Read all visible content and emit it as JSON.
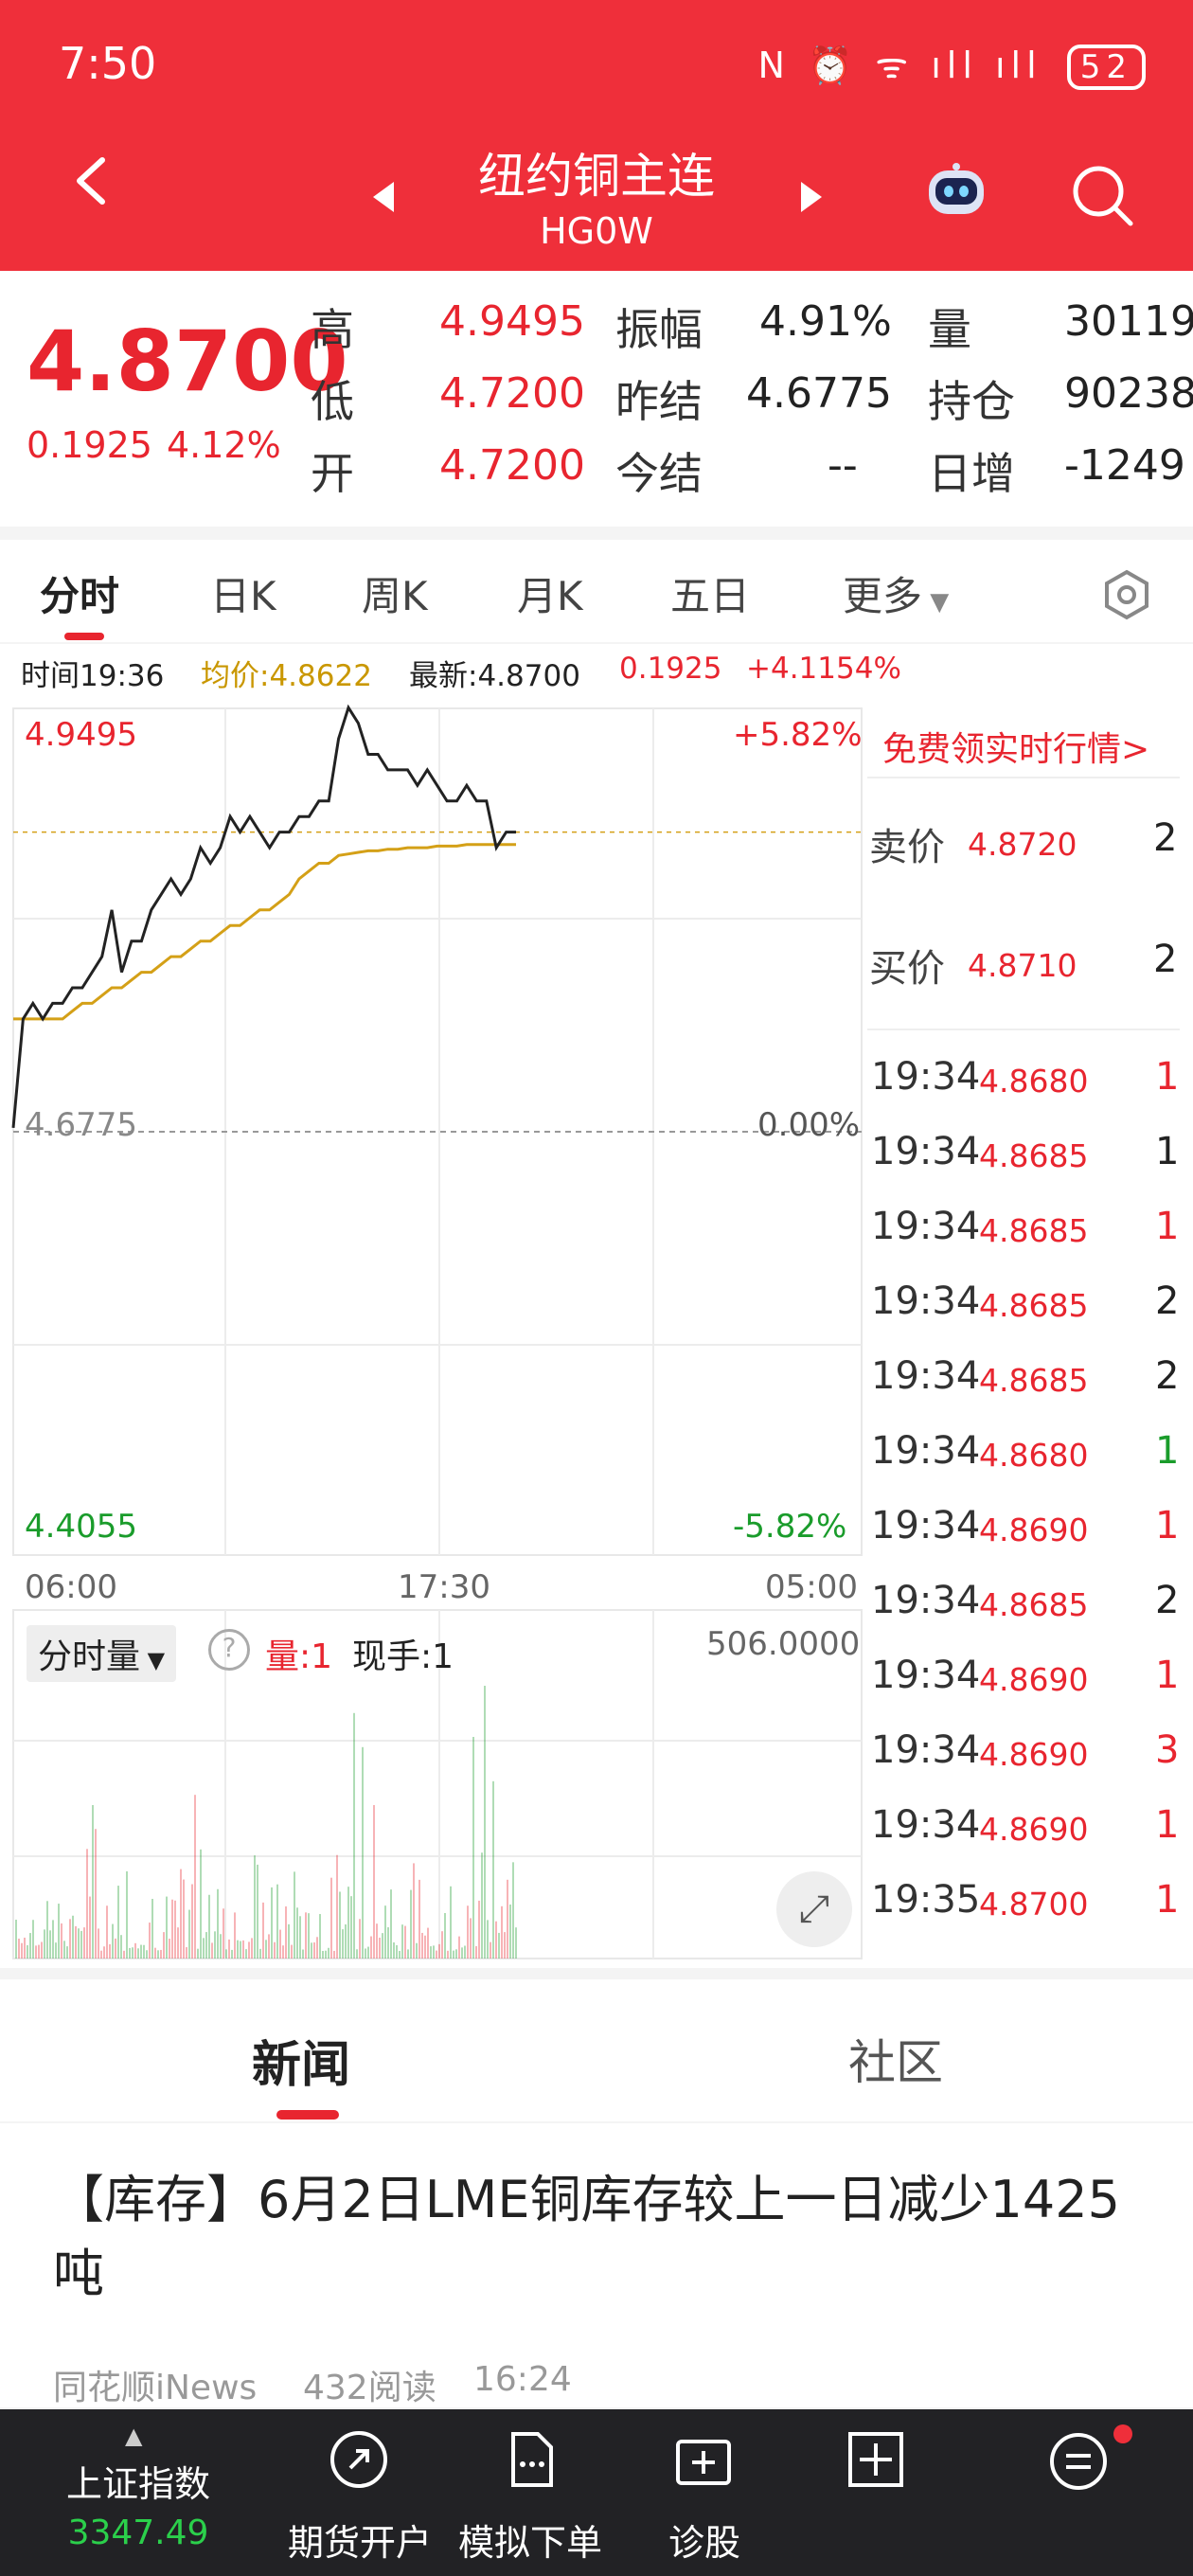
{
  "status_bar": {
    "time": "7:50",
    "icons": "N ⏰ ᯤ ıll ıll",
    "battery": "52"
  },
  "header": {
    "title": "纽约铜主连",
    "subtitle": "HG0W"
  },
  "quote": {
    "last_price": "4.8700",
    "change": "0.1925",
    "change_pct": "4.12%",
    "rows": [
      {
        "l1": "高",
        "v1": "4.9495",
        "l2": "振幅",
        "v2": "4.91%",
        "l3": "量",
        "v3": "30119"
      },
      {
        "l1": "低",
        "v1": "4.7200",
        "l2": "昨结",
        "v2": "4.6775",
        "l3": "持仓",
        "v3": "90238"
      },
      {
        "l1": "开",
        "v1": "4.7200",
        "l2": "今结",
        "v2": "--",
        "l3": "日增",
        "v3": "-1249"
      }
    ]
  },
  "tabs": [
    "分时",
    "日K",
    "周K",
    "月K",
    "五日",
    "更多"
  ],
  "info_line": {
    "time": "时间19:36",
    "avg": "均价:4.8622",
    "latest": "最新:4.8700",
    "chg": "0.1925",
    "pct": "+4.1154%"
  },
  "chart_data": {
    "type": "line",
    "title": "",
    "y_left_ticks": [
      "4.9495",
      "4.6775",
      "4.4055"
    ],
    "y_right_ticks": [
      "+5.82%",
      "0.00%",
      "-5.82%"
    ],
    "x_ticks": [
      "06:00",
      "17:30",
      "05:00"
    ],
    "ylim": [
      4.4055,
      4.9495
    ],
    "series": [
      {
        "values": [
          4.68,
          4.75,
          4.76,
          4.75,
          4.76,
          4.76,
          4.77,
          4.77,
          4.78,
          4.79,
          4.82,
          4.78,
          4.8,
          4.8,
          4.82,
          4.83,
          4.84,
          4.83,
          4.84,
          4.86,
          4.85,
          4.86,
          4.88,
          4.87,
          4.88,
          4.87,
          4.86,
          4.87,
          4.87,
          4.88,
          4.88,
          4.89,
          4.89,
          4.93,
          4.95,
          4.94,
          4.92,
          4.92,
          4.91,
          4.91,
          4.91,
          4.9,
          4.91,
          4.9,
          4.89,
          4.89,
          4.9,
          4.89,
          4.89,
          4.86,
          4.87,
          4.87
        ]
      },
      {
        "values": [
          4.75,
          4.75,
          4.75,
          4.75,
          4.75,
          4.75,
          4.755,
          4.76,
          4.76,
          4.765,
          4.77,
          4.77,
          4.775,
          4.78,
          4.78,
          4.785,
          4.79,
          4.79,
          4.795,
          4.8,
          4.8,
          4.805,
          4.81,
          4.81,
          4.815,
          4.82,
          4.82,
          4.825,
          4.83,
          4.84,
          4.845,
          4.85,
          4.85,
          4.855,
          4.856,
          4.857,
          4.858,
          4.858,
          4.859,
          4.859,
          4.86,
          4.86,
          4.86,
          4.861,
          4.861,
          4.861,
          4.862,
          4.862,
          4.862,
          4.862,
          4.862,
          4.862
        ]
      }
    ],
    "volume_max": "506.0000"
  },
  "volume_panel": {
    "selector": "分时量",
    "help": "?",
    "vol": "量:1",
    "hand": "现手:1",
    "max": "506.0000"
  },
  "side_panel": {
    "promo": "免费领实时行情>",
    "ask_label": "卖价",
    "ask_price": "4.8720",
    "ask_vol": "2",
    "bid_label": "买价",
    "bid_price": "4.8710",
    "bid_vol": "2",
    "ticks": [
      {
        "time": "19:34",
        "price": "4.8680",
        "vol": "1",
        "dir": "red"
      },
      {
        "time": "19:34",
        "price": "4.8685",
        "vol": "1",
        "dir": "black"
      },
      {
        "time": "19:34",
        "price": "4.8685",
        "vol": "1",
        "dir": "red"
      },
      {
        "time": "19:34",
        "price": "4.8685",
        "vol": "2",
        "dir": "black"
      },
      {
        "time": "19:34",
        "price": "4.8685",
        "vol": "2",
        "dir": "black"
      },
      {
        "time": "19:34",
        "price": "4.8680",
        "vol": "1",
        "dir": "green"
      },
      {
        "time": "19:34",
        "price": "4.8690",
        "vol": "1",
        "dir": "red"
      },
      {
        "time": "19:34",
        "price": "4.8685",
        "vol": "2",
        "dir": "black"
      },
      {
        "time": "19:34",
        "price": "4.8690",
        "vol": "1",
        "dir": "red"
      },
      {
        "time": "19:34",
        "price": "4.8690",
        "vol": "3",
        "dir": "red"
      },
      {
        "time": "19:34",
        "price": "4.8690",
        "vol": "1",
        "dir": "red"
      },
      {
        "time": "19:35",
        "price": "4.8700",
        "vol": "1",
        "dir": "red"
      }
    ]
  },
  "news": {
    "tabs": [
      "新闻",
      "社区"
    ],
    "headline": "【库存】6月2日LME铜库存较上一日减少1425吨",
    "source": "同花顺iNews",
    "reads": "432阅读",
    "time": "16:24"
  },
  "bottom_nav": {
    "index_name": "上证指数",
    "index_value": "3347.49",
    "items": [
      "期货开户",
      "模拟下单",
      "诊股"
    ]
  },
  "colors": {
    "brand": "#ef2f3a",
    "up": "#e8252f",
    "down": "#1a9c2b",
    "avg_line": "#d4a017"
  }
}
